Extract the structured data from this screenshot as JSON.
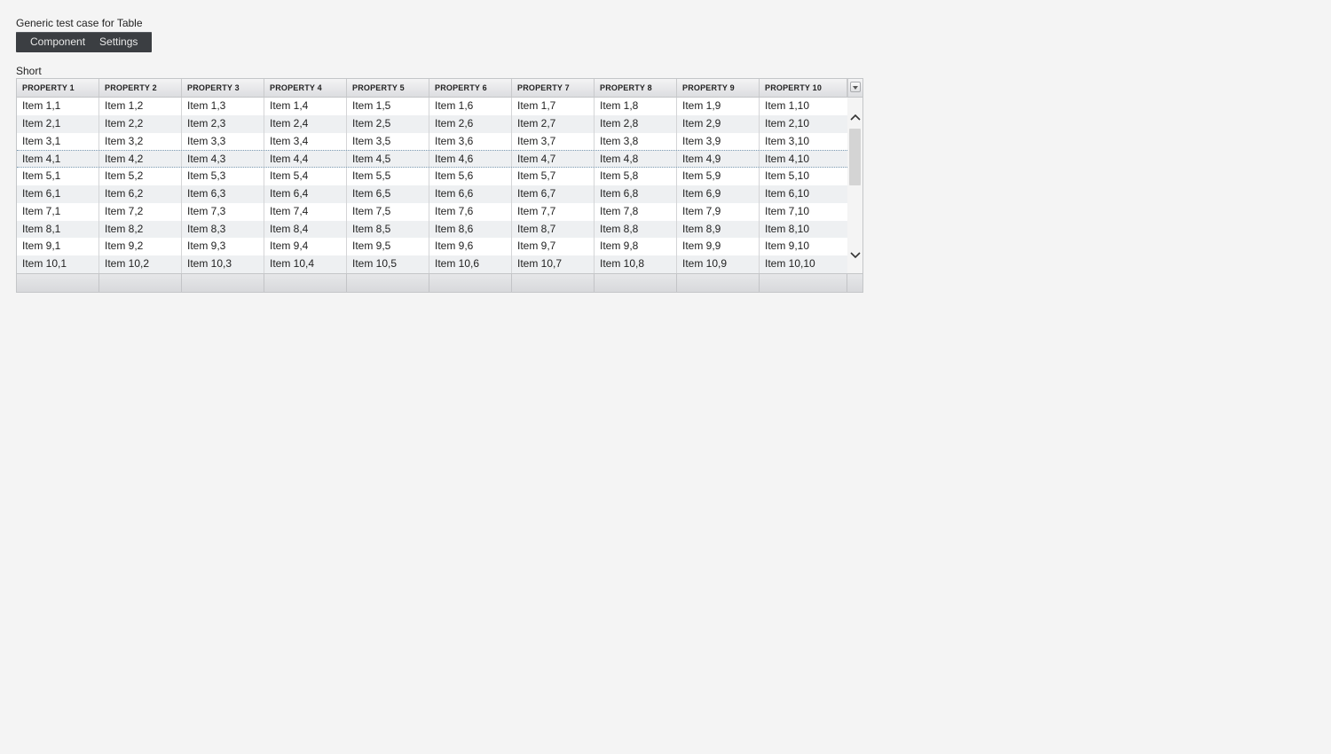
{
  "page": {
    "title": "Generic test case for Table"
  },
  "menubar": {
    "items": [
      {
        "label": "Component"
      },
      {
        "label": "Settings"
      }
    ]
  },
  "table": {
    "caption": "Short",
    "columns": [
      "PROPERTY 1",
      "PROPERTY 2",
      "PROPERTY 3",
      "PROPERTY 4",
      "PROPERTY 5",
      "PROPERTY 6",
      "PROPERTY 7",
      "PROPERTY 8",
      "PROPERTY 9",
      "PROPERTY 10"
    ],
    "rows": [
      [
        "Item 1,1",
        "Item 1,2",
        "Item 1,3",
        "Item 1,4",
        "Item 1,5",
        "Item 1,6",
        "Item 1,7",
        "Item 1,8",
        "Item 1,9",
        "Item 1,10"
      ],
      [
        "Item 2,1",
        "Item 2,2",
        "Item 2,3",
        "Item 2,4",
        "Item 2,5",
        "Item 2,6",
        "Item 2,7",
        "Item 2,8",
        "Item 2,9",
        "Item 2,10"
      ],
      [
        "Item 3,1",
        "Item 3,2",
        "Item 3,3",
        "Item 3,4",
        "Item 3,5",
        "Item 3,6",
        "Item 3,7",
        "Item 3,8",
        "Item 3,9",
        "Item 3,10"
      ],
      [
        "Item 4,1",
        "Item 4,2",
        "Item 4,3",
        "Item 4,4",
        "Item 4,5",
        "Item 4,6",
        "Item 4,7",
        "Item 4,8",
        "Item 4,9",
        "Item 4,10"
      ],
      [
        "Item 5,1",
        "Item 5,2",
        "Item 5,3",
        "Item 5,4",
        "Item 5,5",
        "Item 5,6",
        "Item 5,7",
        "Item 5,8",
        "Item 5,9",
        "Item 5,10"
      ],
      [
        "Item 6,1",
        "Item 6,2",
        "Item 6,3",
        "Item 6,4",
        "Item 6,5",
        "Item 6,6",
        "Item 6,7",
        "Item 6,8",
        "Item 6,9",
        "Item 6,10"
      ],
      [
        "Item 7,1",
        "Item 7,2",
        "Item 7,3",
        "Item 7,4",
        "Item 7,5",
        "Item 7,6",
        "Item 7,7",
        "Item 7,8",
        "Item 7,9",
        "Item 7,10"
      ],
      [
        "Item 8,1",
        "Item 8,2",
        "Item 8,3",
        "Item 8,4",
        "Item 8,5",
        "Item 8,6",
        "Item 8,7",
        "Item 8,8",
        "Item 8,9",
        "Item 8,10"
      ],
      [
        "Item 9,1",
        "Item 9,2",
        "Item 9,3",
        "Item 9,4",
        "Item 9,5",
        "Item 9,6",
        "Item 9,7",
        "Item 9,8",
        "Item 9,9",
        "Item 9,10"
      ],
      [
        "Item 10,1",
        "Item 10,2",
        "Item 10,3",
        "Item 10,4",
        "Item 10,5",
        "Item 10,6",
        "Item 10,7",
        "Item 10,8",
        "Item 10,9",
        "Item 10,10"
      ]
    ],
    "focused_row_index": 3,
    "icons": {
      "column_toggle": "chevron-down-icon",
      "scroll_up": "chevron-up-icon",
      "scroll_down": "chevron-down-icon"
    }
  },
  "colors": {
    "menubar_bg": "#3b3e42",
    "row_alt_bg": "#eef0f2",
    "focus_border": "#7d9bb3"
  }
}
